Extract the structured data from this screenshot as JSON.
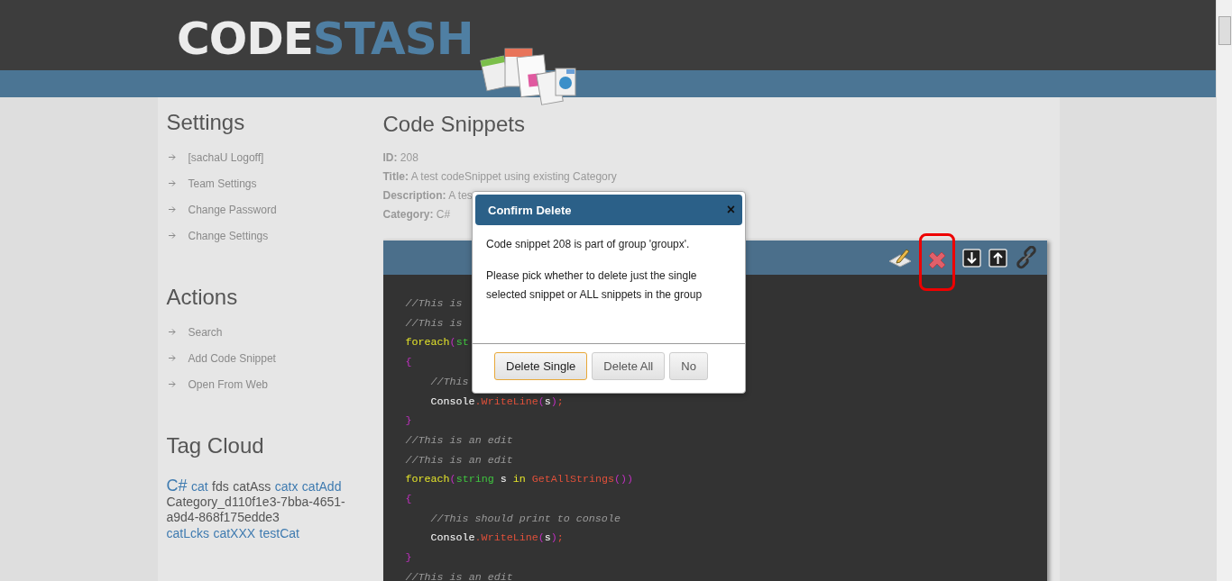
{
  "logo": {
    "part_1": "CODE",
    "part_2": "STASH"
  },
  "sidebar": [
    {
      "heading": "Settings",
      "items": [
        "[sachaU Logoff]",
        "Team Settings",
        "Change Password",
        "Change Settings"
      ]
    },
    {
      "heading": "Actions",
      "items": [
        "Search",
        "Add Code Snippet",
        "Open From Web"
      ]
    }
  ],
  "tag_cloud": {
    "heading": "Tag Cloud",
    "tags": [
      {
        "label": "C#",
        "kind": "large",
        "color": "#3f7bb0"
      },
      {
        "label": "cat",
        "kind": "normal",
        "color": "#3f7bb0"
      },
      {
        "label": "fds",
        "kind": "normal",
        "color": "#555555"
      },
      {
        "label": "catAss",
        "kind": "normal",
        "color": "#555555"
      },
      {
        "label": "catx",
        "kind": "normal",
        "color": "#3f7bb0"
      },
      {
        "label": "catAdd",
        "kind": "normal",
        "color": "#3f7bb0"
      },
      {
        "label": "Category_d110f1e3-7bba-4651-a9d4-868f175edde3",
        "kind": "normal",
        "color": "#555555"
      },
      {
        "label": "catLcks",
        "kind": "normal",
        "color": "#3f7bb0"
      },
      {
        "label": "catXXX",
        "kind": "normal",
        "color": "#3f7bb0"
      },
      {
        "label": "testCat",
        "kind": "normal",
        "color": "#3f7bb0"
      }
    ]
  },
  "main": {
    "title": "Code Snippets",
    "fields": [
      {
        "label": "ID:",
        "value": "208"
      },
      {
        "label": "Title:",
        "value": "A test codeSnippet using existing Category"
      },
      {
        "label": "Description:",
        "value": "A tes"
      },
      {
        "label": "Category:",
        "value": "C#"
      }
    ],
    "toolbar": [
      {
        "kind": "edit",
        "highlighted": false
      },
      {
        "kind": "delete",
        "highlighted": true
      },
      {
        "kind": "down",
        "highlighted": false
      },
      {
        "kind": "up",
        "highlighted": false
      },
      {
        "kind": "link",
        "highlighted": false
      }
    ],
    "code_lines": [
      {
        "indent": false,
        "tokens": [
          {
            "kind": "comment",
            "text": "//This is"
          }
        ]
      },
      {
        "indent": false,
        "tokens": [
          {
            "kind": "comment",
            "text": "//This is"
          }
        ]
      },
      {
        "indent": false,
        "tokens": [
          {
            "kind": "keyword",
            "text": "foreach"
          },
          {
            "kind": "punct",
            "text": "("
          },
          {
            "kind": "type",
            "text": "st"
          }
        ]
      },
      {
        "indent": false,
        "tokens": [
          {
            "kind": "punct",
            "text": "{"
          }
        ]
      },
      {
        "indent": true,
        "tokens": [
          {
            "kind": "comment",
            "text": "//This"
          }
        ]
      },
      {
        "indent": true,
        "tokens": [
          {
            "kind": "plain",
            "text": "Console"
          },
          {
            "kind": "method",
            "text": ".WriteLine"
          },
          {
            "kind": "punct",
            "text": "("
          },
          {
            "kind": "plain",
            "text": "s"
          },
          {
            "kind": "punct",
            "text": ")"
          },
          {
            "kind": "method",
            "text": ";"
          }
        ]
      },
      {
        "indent": false,
        "tokens": [
          {
            "kind": "punct",
            "text": "}"
          }
        ]
      },
      {
        "indent": false,
        "tokens": [
          {
            "kind": "comment",
            "text": "//This is an edit"
          }
        ]
      },
      {
        "indent": false,
        "tokens": [
          {
            "kind": "comment",
            "text": "//This is an edit"
          }
        ]
      },
      {
        "indent": false,
        "tokens": [
          {
            "kind": "keyword",
            "text": "foreach"
          },
          {
            "kind": "punct",
            "text": "("
          },
          {
            "kind": "type",
            "text": "string"
          },
          {
            "kind": "plain",
            "text": " s "
          },
          {
            "kind": "keyword",
            "text": "in"
          },
          {
            "kind": "method",
            "text": " GetAllStrings"
          },
          {
            "kind": "punct",
            "text": "())"
          }
        ]
      },
      {
        "indent": false,
        "tokens": [
          {
            "kind": "punct",
            "text": "{"
          }
        ]
      },
      {
        "indent": true,
        "tokens": [
          {
            "kind": "comment",
            "text": "//This should print to console"
          }
        ]
      },
      {
        "indent": true,
        "tokens": [
          {
            "kind": "plain",
            "text": "Console"
          },
          {
            "kind": "method",
            "text": ".WriteLine"
          },
          {
            "kind": "punct",
            "text": "("
          },
          {
            "kind": "plain",
            "text": "s"
          },
          {
            "kind": "punct",
            "text": ")"
          },
          {
            "kind": "method",
            "text": ";"
          }
        ]
      },
      {
        "indent": false,
        "tokens": [
          {
            "kind": "punct",
            "text": "}"
          }
        ]
      },
      {
        "indent": false,
        "tokens": [
          {
            "kind": "comment",
            "text": "//This is an edit"
          }
        ]
      }
    ]
  },
  "dialog": {
    "title": "Confirm Delete",
    "close": "×",
    "paragraphs": [
      "Code snippet 208 is part of group 'groupx'.",
      "Please pick whether to delete just the single selected snippet or ALL snippets in the group"
    ],
    "buttons": [
      {
        "label": "Delete Single",
        "selected": true
      },
      {
        "label": "Delete All",
        "selected": false
      },
      {
        "label": "No",
        "selected": false
      }
    ]
  }
}
